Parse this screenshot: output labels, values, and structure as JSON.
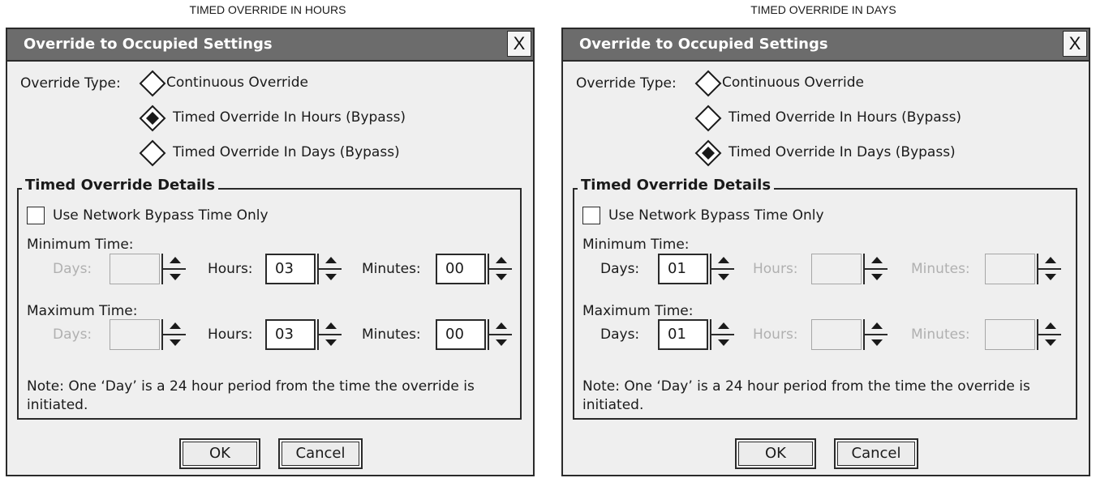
{
  "captions": {
    "left": "TIMED OVERRIDE IN HOURS",
    "right": "TIMED OVERRIDE IN DAYS"
  },
  "dialogs": [
    {
      "title": "Override to Occupied Settings",
      "close_label": "X",
      "override_type_label": "Override Type:",
      "options": [
        {
          "label": "Continuous Override",
          "selected": false
        },
        {
          "label": "Timed Override In Hours (Bypass)",
          "selected": true
        },
        {
          "label": "Timed Override In Days (Bypass)",
          "selected": false
        }
      ],
      "details_title": "Timed Override Details",
      "network_bypass_label": "Use Network Bypass Time Only",
      "network_bypass_checked": false,
      "min_time_label": "Minimum Time:",
      "max_time_label": "Maximum Time:",
      "days_label": "Days:",
      "hours_label": "Hours:",
      "minutes_label": "Minutes:",
      "min": {
        "days": "",
        "hours": "03",
        "minutes": "00"
      },
      "max": {
        "days": "",
        "hours": "03",
        "minutes": "00"
      },
      "enabled": {
        "days": false,
        "hours": true,
        "minutes": true
      },
      "note": "Note: One ‘Day’ is a 24 hour period from the time the override is initiated.",
      "ok_label": "OK",
      "cancel_label": "Cancel"
    },
    {
      "title": "Override to Occupied Settings",
      "close_label": "X",
      "override_type_label": "Override Type:",
      "options": [
        {
          "label": "Continuous Override",
          "selected": false
        },
        {
          "label": "Timed Override In Hours (Bypass)",
          "selected": false
        },
        {
          "label": "Timed Override In Days (Bypass)",
          "selected": true
        }
      ],
      "details_title": "Timed Override Details",
      "network_bypass_label": "Use Network Bypass Time Only",
      "network_bypass_checked": false,
      "min_time_label": "Minimum Time:",
      "max_time_label": "Maximum Time:",
      "days_label": "Days:",
      "hours_label": "Hours:",
      "minutes_label": "Minutes:",
      "min": {
        "days": "01",
        "hours": "",
        "minutes": ""
      },
      "max": {
        "days": "01",
        "hours": "",
        "minutes": ""
      },
      "enabled": {
        "days": true,
        "hours": false,
        "minutes": false
      },
      "note": "Note: One ‘Day’ is a 24 hour period from the time the override is initiated.",
      "ok_label": "OK",
      "cancel_label": "Cancel"
    }
  ],
  "colors": {
    "titlebar": "#6c6c6c",
    "dialog_bg": "#efefef",
    "border": "#2a2a2a",
    "disabled_text": "#b0b0b0"
  }
}
